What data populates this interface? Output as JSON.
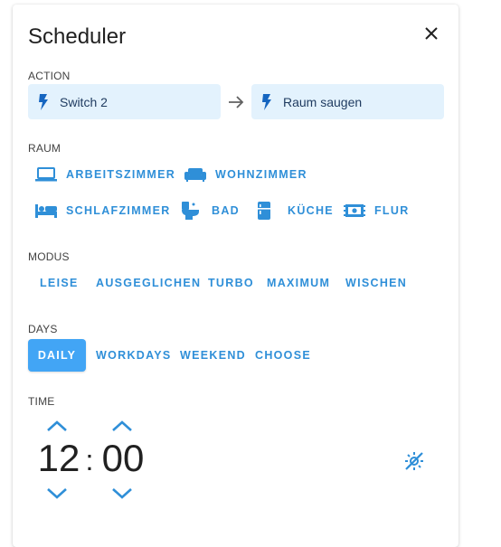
{
  "dialog": {
    "title": "Scheduler"
  },
  "action": {
    "label": "ACTION",
    "source": "Switch 2",
    "target": "Raum saugen"
  },
  "raum": {
    "label": "RAUM",
    "rooms": [
      {
        "label": "ARBEITSZIMMER",
        "icon": "laptop-icon"
      },
      {
        "label": "WOHNZIMMER",
        "icon": "sofa-icon"
      },
      {
        "label": "SCHLAFZIMMER",
        "icon": "bed-icon"
      },
      {
        "label": "BAD",
        "icon": "toilet-icon"
      },
      {
        "label": "KÜCHE",
        "icon": "fridge-icon"
      },
      {
        "label": "FLUR",
        "icon": "rug-icon"
      }
    ]
  },
  "modus": {
    "label": "MODUS",
    "options": [
      "LEISE",
      "AUSGEGLICHEN",
      "TURBO",
      "MAXIMUM",
      "WISCHEN"
    ]
  },
  "days": {
    "label": "DAYS",
    "options": [
      "DAILY",
      "WORKDAYS",
      "WEEKEND",
      "CHOOSE"
    ],
    "selected": "DAILY"
  },
  "time": {
    "label": "TIME",
    "hours": "12",
    "separator": ":",
    "minutes": "00"
  },
  "colors": {
    "accent": "#2f8fd8",
    "selected_button": "#42a5f5",
    "action_box": "#e3f2fd"
  }
}
